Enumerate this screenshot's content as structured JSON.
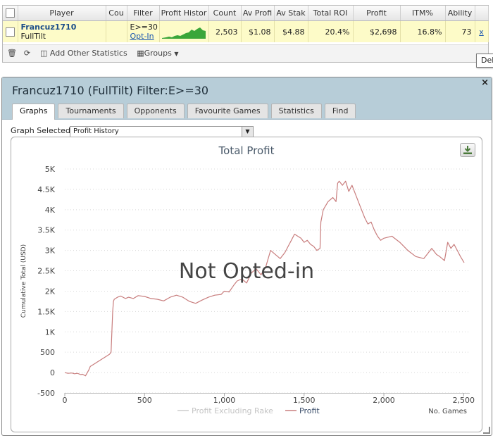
{
  "grid": {
    "columns": [
      "Player",
      "Cou",
      "Filter",
      "Profit Histor",
      "Count",
      "Av Profi",
      "Av Stak",
      "Total ROI",
      "Profit",
      "ITM%",
      "Ability"
    ],
    "row": {
      "player_name": "Francuz1710",
      "site": "FullTilt",
      "filter": "E>=30",
      "opt_in": "Opt-In",
      "count": "2,503",
      "av_profit": "$1.08",
      "av_stake": "$4.88",
      "total_roi": "20.4%",
      "profit": "$2,698",
      "itm": "16.8%",
      "ability": "73",
      "delete": "x"
    },
    "toolbar": {
      "add_stats": "Add Other Statistics",
      "groups": "Groups"
    },
    "tooltip": "Del"
  },
  "dialog": {
    "title": "Francuz1710 (FullTilt) Filter:E>=30",
    "close": "×",
    "tabs": [
      "Graphs",
      "Tournaments",
      "Opponents",
      "Favourite Games",
      "Statistics",
      "Find"
    ],
    "graph_selected_label": "Graph Selected:",
    "graph_selected_value": "Profit History"
  },
  "colors": {
    "profit_line": "#c87d7d",
    "sparkline": "#3aa63a",
    "excluding_rake_line": "#cccccc",
    "header_bg": "#b7cdd8",
    "row_highlight": "#fdfbc8"
  },
  "chart_data": {
    "type": "line",
    "title": "Total Profit",
    "xlabel": "No. Games",
    "ylabel": "Cumulative Total (USD)",
    "watermark": "Not Opted-in",
    "xlim": [
      0,
      2503
    ],
    "ylim": [
      -500,
      5000
    ],
    "x_ticks": [
      0,
      500,
      1000,
      1500,
      2000,
      2500
    ],
    "x_tick_labels": [
      "0",
      "500",
      "1,000",
      "1,500",
      "2,000",
      "2,500"
    ],
    "y_ticks": [
      -500,
      0,
      500,
      1000,
      1500,
      2000,
      2500,
      3000,
      3500,
      4000,
      4500,
      5000
    ],
    "y_tick_labels": [
      "-500",
      "0",
      "500",
      "1K",
      "1.5K",
      "2K",
      "2.5K",
      "3K",
      "3.5K",
      "4K",
      "4.5K",
      "5K"
    ],
    "grid": true,
    "legend_position": "bottom-center",
    "series": [
      {
        "name": "Profit Excluding Rake",
        "x": [],
        "y": []
      },
      {
        "name": "Profit",
        "x": [
          0,
          20,
          45,
          60,
          80,
          100,
          110,
          130,
          150,
          160,
          180,
          200,
          220,
          240,
          260,
          280,
          290,
          300,
          305,
          310,
          330,
          350,
          380,
          400,
          430,
          460,
          500,
          540,
          580,
          620,
          660,
          700,
          740,
          780,
          820,
          860,
          900,
          940,
          980,
          1000,
          1030,
          1060,
          1080,
          1110,
          1140,
          1170,
          1200,
          1230,
          1260,
          1290,
          1320,
          1350,
          1380,
          1400,
          1420,
          1440,
          1460,
          1480,
          1500,
          1520,
          1540,
          1560,
          1580,
          1600,
          1605,
          1620,
          1650,
          1680,
          1700,
          1710,
          1720,
          1740,
          1760,
          1780,
          1800,
          1820,
          1840,
          1860,
          1880,
          1900,
          1920,
          1940,
          1960,
          1980,
          2000,
          2050,
          2100,
          2150,
          2200,
          2250,
          2300,
          2330,
          2350,
          2380,
          2400,
          2420,
          2440,
          2460,
          2480,
          2503
        ],
        "y": [
          0,
          -20,
          -10,
          -30,
          -20,
          -50,
          -40,
          -80,
          60,
          150,
          200,
          250,
          300,
          350,
          400,
          450,
          500,
          1500,
          1750,
          1800,
          1850,
          1880,
          1820,
          1850,
          1820,
          1890,
          1870,
          1820,
          1800,
          1760,
          1850,
          1900,
          1850,
          1750,
          1700,
          1780,
          1850,
          1900,
          1920,
          2000,
          1980,
          2150,
          2250,
          2300,
          2200,
          2450,
          2550,
          2400,
          2600,
          3000,
          2900,
          2800,
          2950,
          3100,
          3250,
          3400,
          3350,
          3300,
          3200,
          3250,
          3150,
          3100,
          3000,
          3050,
          3700,
          4000,
          4200,
          4300,
          4200,
          4650,
          4700,
          4600,
          4700,
          4450,
          4600,
          4400,
          4200,
          4000,
          3800,
          3650,
          3700,
          3500,
          3350,
          3250,
          3300,
          3350,
          3200,
          3000,
          2850,
          2800,
          3050,
          2900,
          2850,
          2750,
          3200,
          3050,
          3150,
          3000,
          2850,
          2700
        ]
      }
    ]
  }
}
